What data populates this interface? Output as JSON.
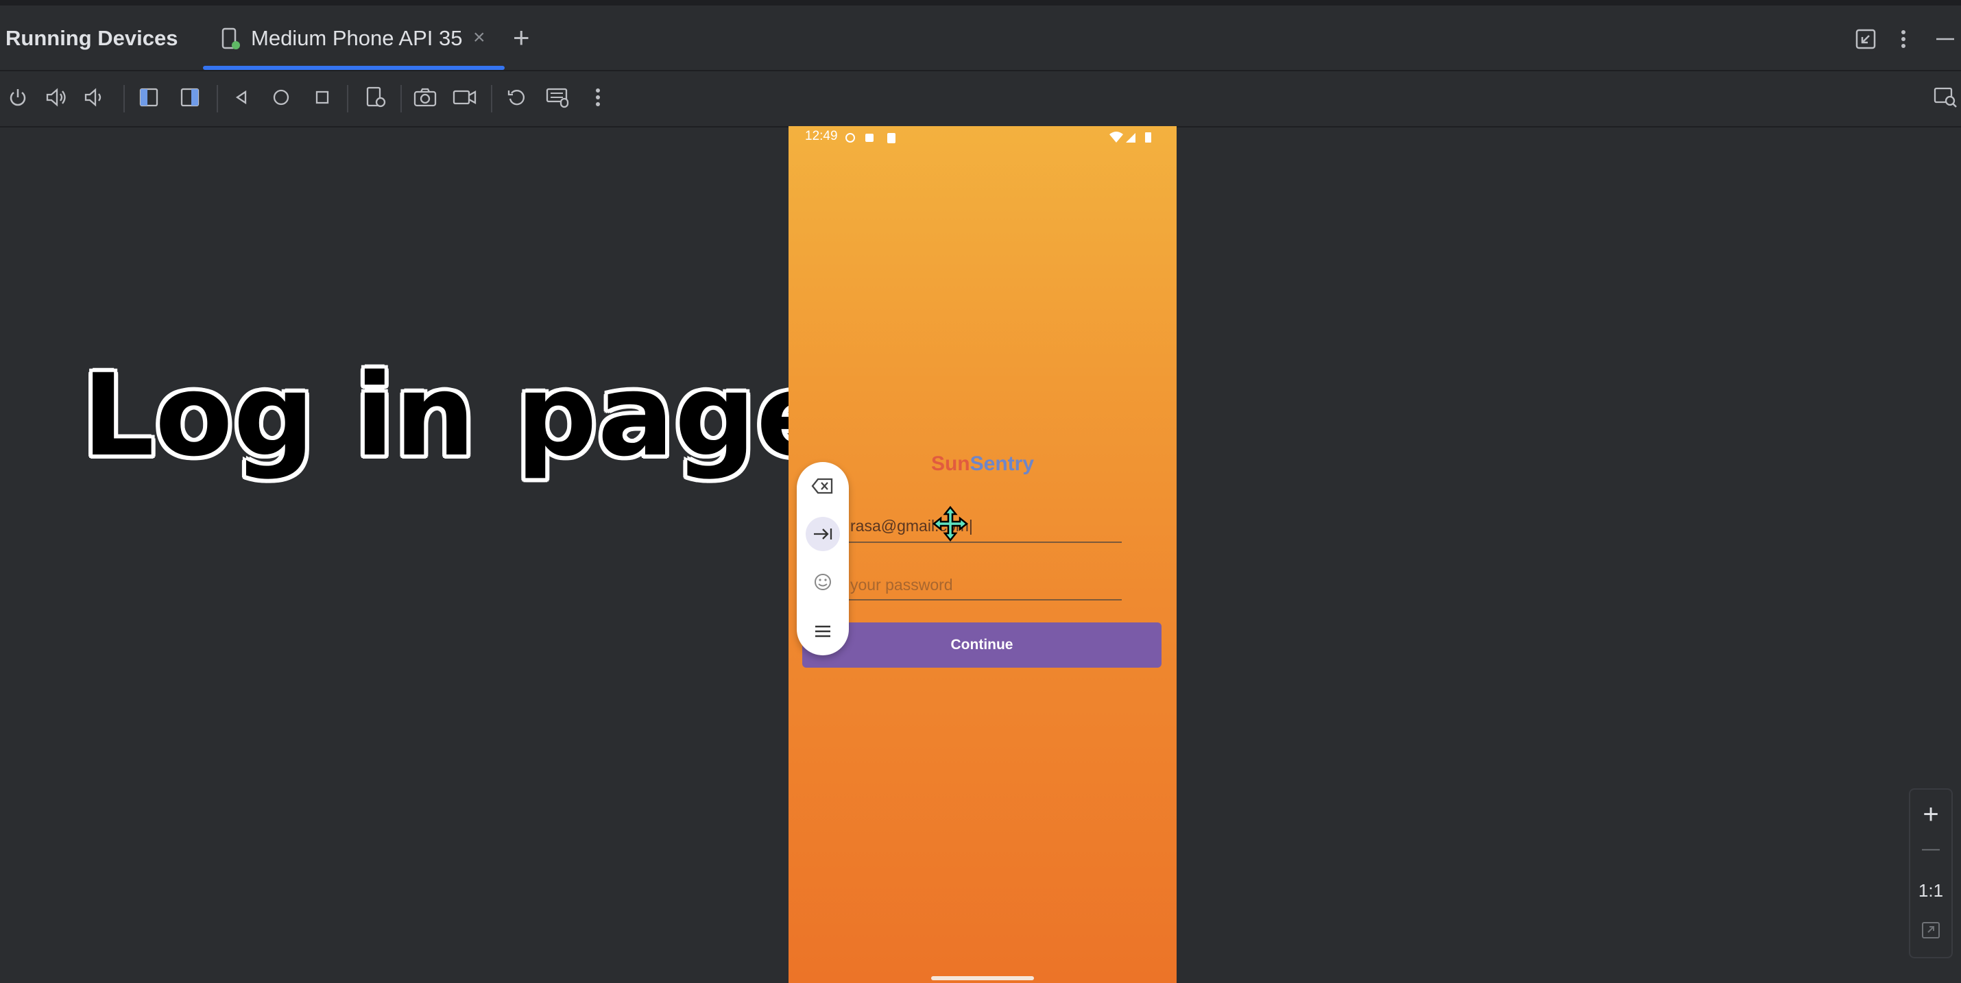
{
  "tool_window": {
    "title": "Running Devices"
  },
  "tabs": [
    {
      "label": "Medium Phone API 35",
      "close": "×"
    }
  ],
  "tab_add": "+",
  "toolbar_icons": [
    "power-icon",
    "volume-up-icon",
    "volume-down-icon",
    "rotate-left-icon",
    "rotate-right-icon",
    "back-icon",
    "home-icon",
    "overview-icon",
    "device-settings-icon",
    "screenshot-icon",
    "screen-record-icon",
    "reset-icon",
    "keyboard-mouse-icon",
    "more-icon"
  ],
  "overlay": {
    "caption": "Log in page!"
  },
  "phone": {
    "status": {
      "time": "12:49"
    },
    "app": {
      "title_part1": "Sun",
      "title_part2": "Sentry",
      "email_value": "rasa@gmail.com|",
      "password_placeholder": "your password",
      "continue_label": "Continue"
    }
  },
  "zoom": {
    "plus": "+",
    "minus": "—",
    "ratio": "1:1"
  },
  "colors": {
    "accent": "#3574f0",
    "button": "#7a5ba8",
    "gradient_top": "#f3b13f",
    "gradient_bottom": "#ec7428"
  }
}
